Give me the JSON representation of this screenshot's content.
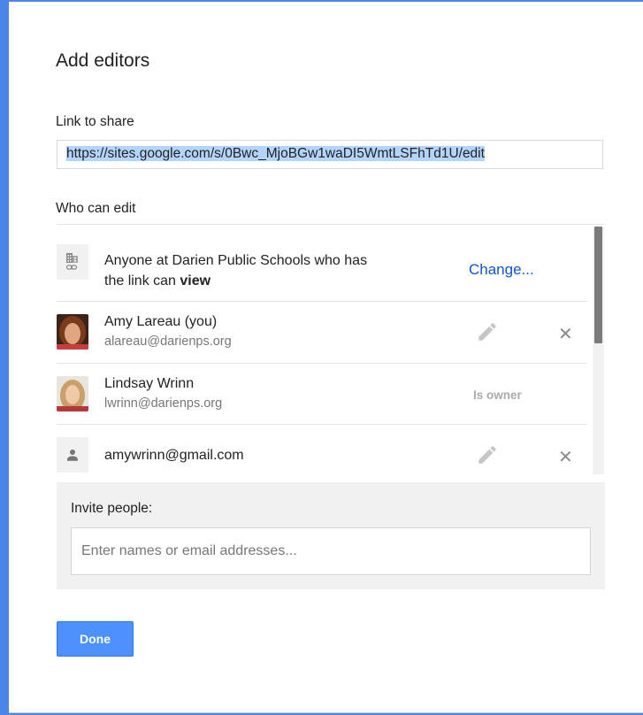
{
  "dialog": {
    "title": "Add editors",
    "link_label": "Link to share",
    "link_url": "https://sites.google.com/s/0Bwc_MjoBGw1waDI5WmtLSFhTd1U/edit",
    "who_label": "Who can edit"
  },
  "access": {
    "line1": "Anyone at Darien Public Schools who has",
    "line2_prefix": "the link can ",
    "line2_bold": "view",
    "change_label": "Change...",
    "icon": "domain-link-icon"
  },
  "editors": [
    {
      "name": "Amy Lareau (you)",
      "email": "alareau@darienps.org",
      "role_icon": "pencil-icon",
      "remove_icon": "close-icon",
      "remove_glyph": "✕"
    },
    {
      "name": "Lindsay Wrinn",
      "email": "lwrinn@darienps.org",
      "role_text": "Is owner"
    },
    {
      "name": "amywrinn@gmail.com",
      "role_icon": "pencil-icon",
      "remove_icon": "close-icon",
      "remove_glyph": "✕",
      "avatar_icon": "person-icon"
    }
  ],
  "invite": {
    "label": "Invite people:",
    "placeholder": "Enter names or email addresses..."
  },
  "footer": {
    "done_label": "Done"
  },
  "colors": {
    "accent": "#4d90fe",
    "link": "#1155cc",
    "selection": "#b3d4fd"
  }
}
